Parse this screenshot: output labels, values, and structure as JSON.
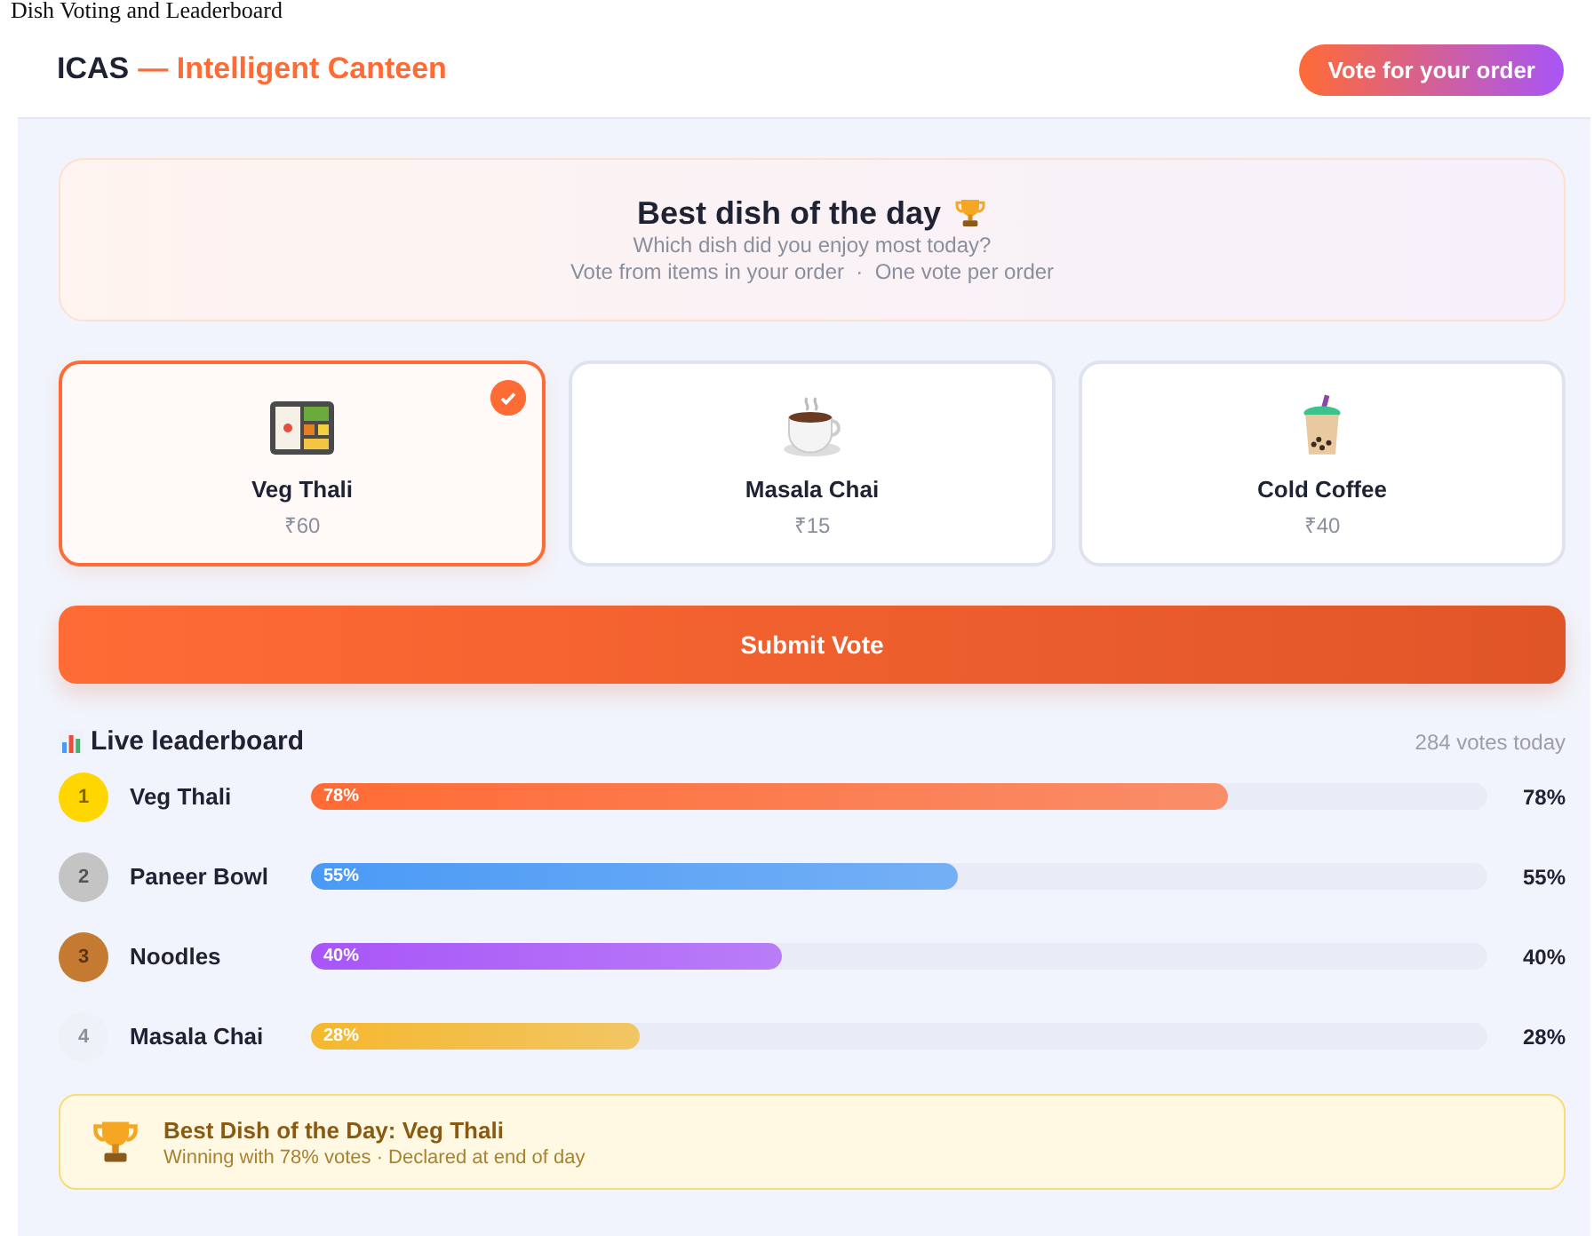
{
  "caption": "Dish Voting and Leaderboard",
  "header": {
    "brand": "ICAS",
    "tagline": "— Intelligent Canteen",
    "button": "Vote for your order"
  },
  "hero": {
    "title": "Best dish of the day",
    "subtitle": "Which dish did you enjoy most today?",
    "rules": "Vote from items in your order  ·  One vote per order"
  },
  "dishes": [
    {
      "name": "Veg Thali",
      "price": "₹60",
      "kind": "thali",
      "selected": true
    },
    {
      "name": "Masala Chai",
      "price": "₹15",
      "kind": "chai",
      "selected": false
    },
    {
      "name": "Cold Coffee",
      "price": "₹40",
      "kind": "coffee",
      "selected": false
    }
  ],
  "submit_button": "Submit Vote",
  "leaderboard": {
    "title": "Live leaderboard",
    "total": "284 votes today",
    "rows": [
      {
        "rank": "1",
        "kind": "gold",
        "name": "Veg Thali",
        "bar_label": "78%",
        "level": 0.78,
        "color": "#ff6b35",
        "percent": "78%"
      },
      {
        "rank": "2",
        "kind": "silver",
        "name": "Paneer Bowl",
        "bar_label": "55%",
        "level": 0.55,
        "color": "#4a9af5",
        "percent": "55%"
      },
      {
        "rank": "3",
        "kind": "bronze",
        "name": "Noodles",
        "bar_label": "40%",
        "level": 0.4,
        "color": "#a855f7",
        "percent": "40%"
      },
      {
        "rank": "4",
        "kind": "plain",
        "name": "Masala Chai",
        "bar_label": "28%",
        "level": 0.28,
        "color": "#f5b82e",
        "percent": "28%"
      }
    ]
  },
  "winner": {
    "title": "Best Dish of the Day: Veg Thali",
    "detail": "Winning with 78% votes · Declared at end of day"
  }
}
